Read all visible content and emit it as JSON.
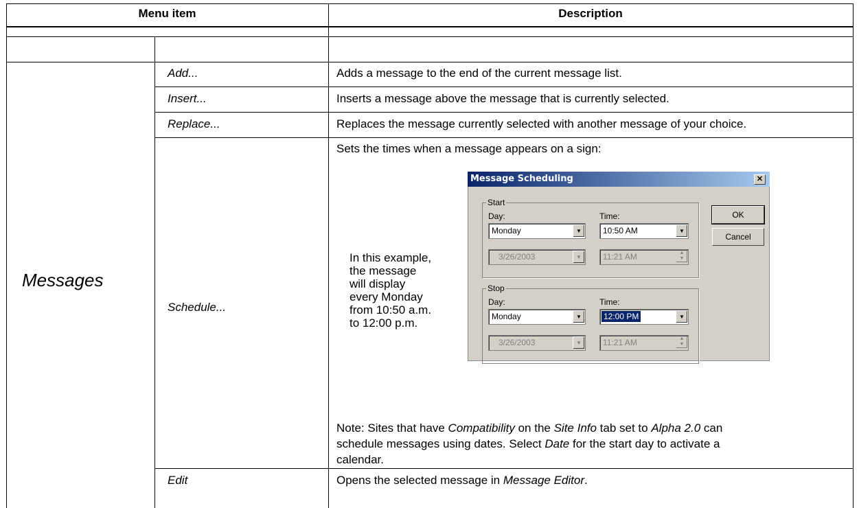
{
  "table": {
    "headers": {
      "menu_item": "Menu item",
      "description": "Description"
    },
    "group_label": "Messages",
    "rows": [
      {
        "item": "Add...",
        "description": "Adds a message to the end of the current message list."
      },
      {
        "item": "Insert...",
        "description": "Inserts a message above the message that is currently selected."
      },
      {
        "item": "Replace...",
        "description": "Replaces the message currently selected with another message of your choice."
      },
      {
        "item": "Schedule...",
        "description": "Sets the times when a message appears on a sign:"
      },
      {
        "item": "Edit",
        "description_prefix": "Opens the selected message in ",
        "description_em": "Message Editor",
        "description_suffix": "."
      }
    ],
    "example_text": [
      "In this example,",
      "the message",
      "will display",
      "every Monday",
      "from 10:50 a.m.",
      "to 12:00 p.m."
    ],
    "note": {
      "p1": "Note: Sites that have ",
      "em1": "Compatibility",
      "p2": " on the ",
      "em2": "Site Info",
      "p3": " tab set to ",
      "em3": "Alpha 2.0",
      "p4": " can",
      "line2": "schedule messages using dates. Select ",
      "em4": "Date",
      "p5": " for the start day to activate a",
      "line3": "calendar."
    }
  },
  "dialog": {
    "title": "Message Scheduling",
    "close": "✕",
    "start": {
      "group": "Start",
      "day_label": "Day:",
      "time_label": "Time:",
      "day": "Monday",
      "time": "10:50 AM",
      "date": "3/26/2003",
      "date_time": "11:21 AM"
    },
    "stop": {
      "group": "Stop",
      "day_label": "Day:",
      "time_label": "Time:",
      "day": "Monday",
      "time": "12:00 PM",
      "date": "3/26/2003",
      "date_time": "11:21 AM"
    },
    "ok": "OK",
    "cancel": "Cancel"
  }
}
